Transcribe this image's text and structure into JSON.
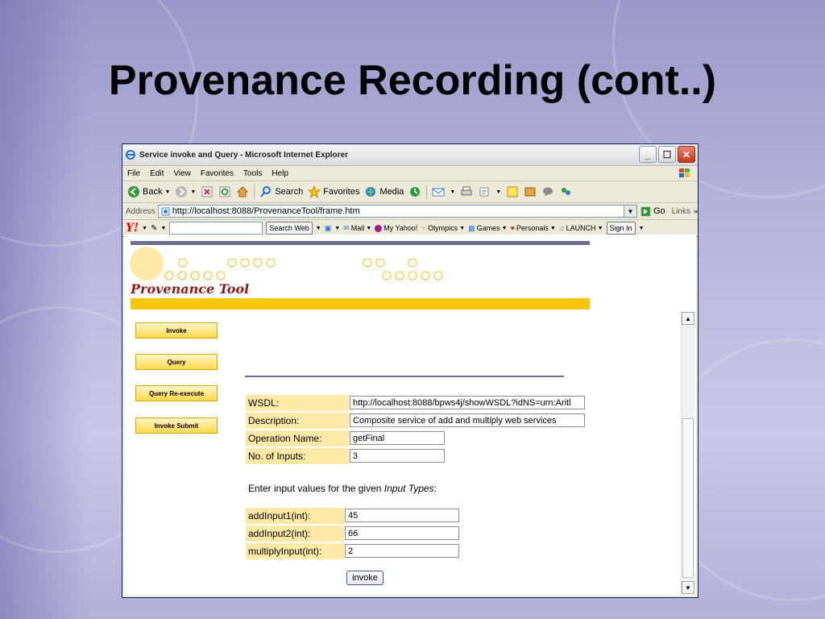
{
  "slide": {
    "title": "Provenance Recording (cont..)"
  },
  "window": {
    "title": "Service invoke and Query - Microsoft Internet Explorer"
  },
  "menu": {
    "items": [
      "File",
      "Edit",
      "View",
      "Favorites",
      "Tools",
      "Help"
    ]
  },
  "toolbar": {
    "back": "Back",
    "search": "Search",
    "favorites": "Favorites",
    "media": "Media"
  },
  "address": {
    "label": "Address",
    "url": "http://localhost:8088/ProvenanceTool/frame.htm",
    "go": "Go",
    "links": "Links"
  },
  "yahoo": {
    "logo": "Y!",
    "search_button": "Search Web",
    "mail": "Mail",
    "my_yahoo": "My Yahoo!",
    "olympics": "Olympics",
    "games": "Games",
    "personals": "Personals",
    "launch": "LAUNCH",
    "sign_in": "Sign In"
  },
  "page": {
    "brand": "Provenance Tool",
    "nav": {
      "invoke": "Invoke",
      "query": "Query",
      "query_reexecute": "Query Re-execute",
      "invoke_submit": "Invoke Submit"
    },
    "form": {
      "wsdl_label": "WSDL:",
      "wsdl_value": "http://localhost:8088/bpws4j/showWSDL?idNS=urn:Aritl",
      "description_label": "Description:",
      "description_value": "Composite service of add and multiply web services",
      "operation_label": "Operation Name:",
      "operation_value": "getFinal",
      "inputs_label": "No. of Inputs:",
      "inputs_value": "3",
      "instruction_prefix": "Enter input values for the given ",
      "instruction_em": "Input Types",
      "instruction_suffix": ":",
      "add1_label": "addInput1(int):",
      "add1_value": "45",
      "add2_label": "addInput2(int):",
      "add2_value": "66",
      "mult_label": "multiplyInput(int):",
      "mult_value": "2",
      "invoke_button": "invoke"
    }
  },
  "colors": {
    "gold": "#f6c600",
    "rule": "#6e6d92",
    "label_bg": "#ffe9a6",
    "brand": "#8b1a1a"
  }
}
